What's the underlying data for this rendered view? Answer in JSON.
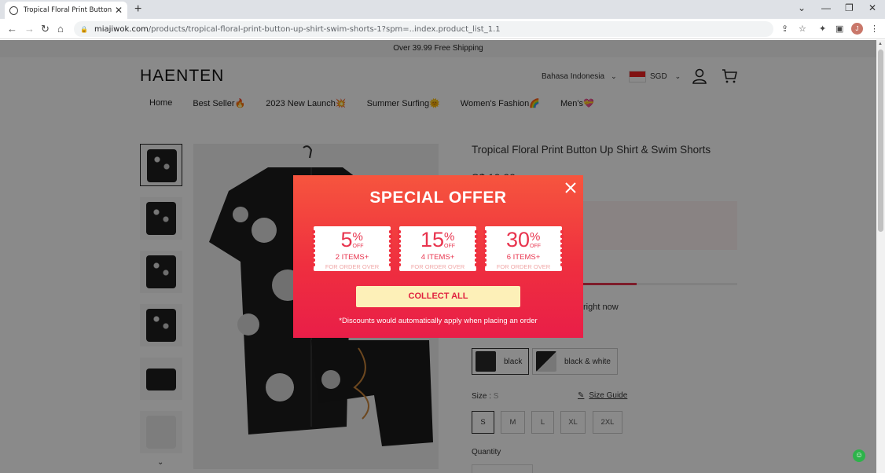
{
  "browser": {
    "tab_title": "Tropical Floral Print Button Up Shi",
    "new_tab": "+",
    "url_host": "miajiwok.com",
    "url_path": "/products/tropical-floral-print-button-up-shirt-swim-shorts-1?spm=..index.product_list_1.1",
    "profile_initial": "J"
  },
  "announcement": "Over 39.99 Free Shipping",
  "header": {
    "logo": "HAENTEN",
    "language": "Bahasa Indonesia",
    "currency": "SGD",
    "nav": [
      "Home",
      "Best Seller🔥",
      "2023 New Launch💥",
      "Summer Surfing🌞",
      "Women's Fashion🌈",
      "Men's💝"
    ]
  },
  "product": {
    "title": "Tropical Floral Print Button Up Shirt & Swim Shorts",
    "price": "S$ 19.99",
    "promo_lines": [
      "2 items 5% off",
      "4 items 15% off",
      "6 items 30% off"
    ],
    "stock_progress": 0.62,
    "viewing": "right now",
    "color_label": "Color : black",
    "colors": [
      "black",
      "black & white"
    ],
    "size_label": "Size : ",
    "size_selected": "S",
    "size_guide": "Size Guide",
    "sizes": [
      "S",
      "M",
      "L",
      "XL",
      "2XL"
    ],
    "quantity_label": "Quantity"
  },
  "modal": {
    "title": "SPECIAL OFFER",
    "coupons": [
      {
        "num": "5",
        "pct": "%",
        "off": "OFF",
        "items": "2 ITEMS+",
        "min": "FOR ORDER OVER"
      },
      {
        "num": "15",
        "pct": "%",
        "off": "OFF",
        "items": "4 ITEMS+",
        "min": "FOR ORDER OVER"
      },
      {
        "num": "30",
        "pct": "%",
        "off": "OFF",
        "items": "6 ITEMS+",
        "min": "FOR ORDER OVER"
      }
    ],
    "collect_label": "COLLECT ALL",
    "note": "*Discounts would automatically apply when placing an order"
  },
  "colors": {
    "accent": "#e8344e",
    "modal_top": "#f6553e",
    "modal_bottom": "#e91e48",
    "button_bg": "#fdf0b8"
  }
}
